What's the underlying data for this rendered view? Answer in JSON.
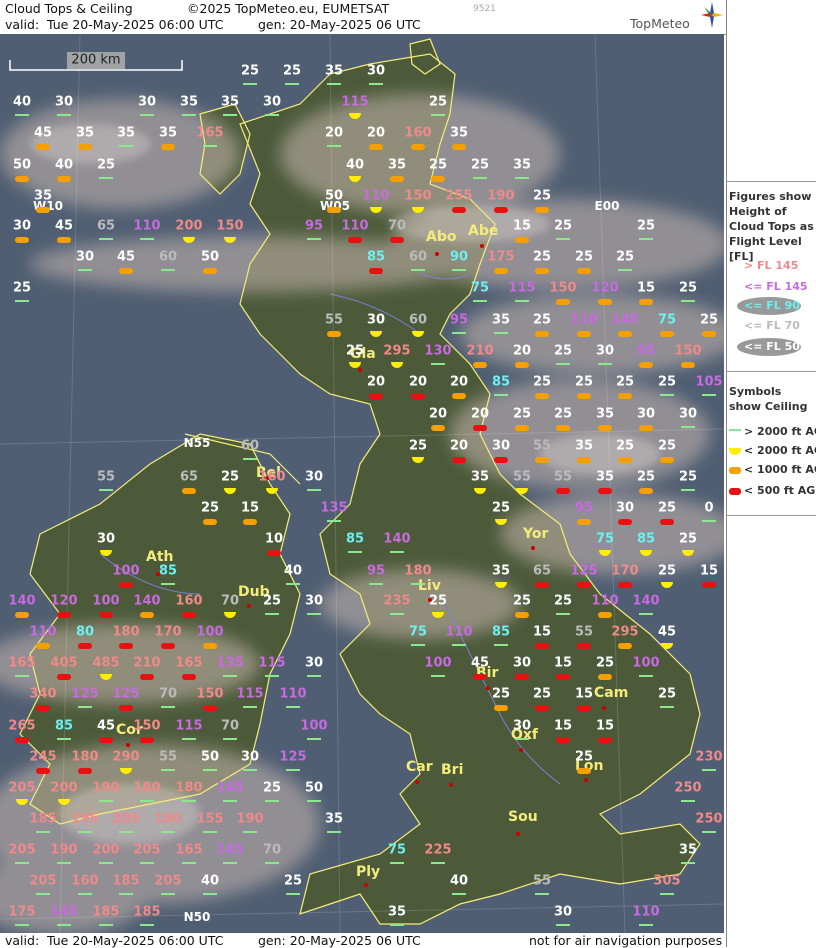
{
  "header": {
    "title": "Cloud Tops & Ceiling",
    "copyright": "©2025 TopMeteo.eu, EUMETSAT",
    "image_code": "9521",
    "valid_label": "valid:",
    "valid_time": "Tue   20-May-2025   06:00 UTC",
    "gen_time": "gen: 20-May-2025 06 UTC",
    "brand": "TopMeteo"
  },
  "footer": {
    "valid_label": "valid:",
    "valid_time": "Tue   20-May-2025   06:00 UTC",
    "gen_time": "gen: 20-May-2025 06 UTC",
    "disclaimer": "not for air navigation purposes"
  },
  "scale_bar": {
    "label": "200 km"
  },
  "grid_labels": [
    "W10",
    "W05",
    "E00",
    "N55",
    "N50"
  ],
  "cities": [
    "Abe",
    "Abo",
    "Gla",
    "Bel",
    "Dub",
    "Liv",
    "Yor",
    "Ath",
    "Bir",
    "Cam",
    "Oxf",
    "Car",
    "Bri",
    "Lon",
    "Sou",
    "Ply",
    "Cor"
  ],
  "legend": {
    "figures_title": "Figures show Height of Cloud Tops as Flight Level [FL]",
    "fl_entries": [
      {
        "label": "> FL 145",
        "color": "#f08a8a",
        "ellipse": false
      },
      {
        "label": "<= FL 145",
        "color": "#c86ae0",
        "ellipse": false
      },
      {
        "label": "<= FL 90",
        "color": "#6cf0f0",
        "ellipse": true
      },
      {
        "label": "<= FL 70",
        "color": "#bbbbbb",
        "ellipse": false
      },
      {
        "label": "<= FL 50",
        "color": "#ffffff",
        "ellipse": true
      }
    ],
    "symbols_title": "Symbols show Ceiling",
    "symbol_entries": [
      {
        "label": "> 2000 ft AGL",
        "shape": "line",
        "color": "#8ce88c"
      },
      {
        "label": "< 2000 ft AGL",
        "shape": "half-circle",
        "color": "#ffee00"
      },
      {
        "label": "< 1000 ft AGL",
        "shape": "bar",
        "color": "#f5a000"
      },
      {
        "label": "< 500 ft AGL",
        "shape": "bar",
        "color": "#e81010"
      }
    ]
  },
  "colors": {
    "fl_high": "#f08a8a",
    "fl_145": "#c86ae0",
    "fl_90": "#6cf0f0",
    "fl_70": "#bbbbbb",
    "fl_50": "#ffffff",
    "ceil_high": "#8ce88c",
    "ceil_2000": "#ffee00",
    "ceil_1000": "#f5a000",
    "ceil_500": "#e81010",
    "coast": "#f4ec7a",
    "sea": "#4f5e72",
    "land": "#4c5a3a",
    "river": "#7a80d0"
  },
  "rows": [
    {
      "cells": [
        [
          "25",
          "g"
        ],
        [
          "25",
          "g"
        ],
        [
          "35",
          "g"
        ],
        [
          "30",
          "g"
        ]
      ]
    },
    {
      "cells": [
        [
          "40",
          "g"
        ],
        [
          "30",
          "g"
        ],
        [
          "30",
          "g"
        ],
        [
          "35",
          "g"
        ],
        [
          "35",
          "g"
        ],
        [
          "30",
          "g"
        ],
        [
          "115",
          "y"
        ],
        [
          "25",
          "g"
        ]
      ]
    },
    {
      "cells": [
        [
          "45",
          "o"
        ],
        [
          "35",
          "o"
        ],
        [
          "35",
          "g"
        ],
        [
          "35",
          "o"
        ],
        [
          "165",
          "g"
        ],
        [
          "20",
          "g"
        ],
        [
          "20",
          "o"
        ],
        [
          "160",
          "o"
        ],
        [
          "35",
          "o"
        ]
      ]
    },
    {
      "cells": [
        [
          "50",
          "o"
        ],
        [
          "40",
          "o"
        ],
        [
          "25",
          "g"
        ],
        [
          "40",
          "y"
        ],
        [
          "35",
          "o"
        ],
        [
          "25",
          "o"
        ],
        [
          "25",
          "g"
        ],
        [
          "35",
          "g"
        ]
      ]
    },
    {
      "cells": [
        [
          "35",
          "o"
        ],
        [
          "50",
          "o"
        ],
        [
          "110",
          "y"
        ],
        [
          "150",
          "y"
        ],
        [
          "255",
          "r"
        ],
        [
          "190",
          "r"
        ],
        [
          "25",
          "o"
        ]
      ]
    },
    {
      "cells": [
        [
          "30",
          "o"
        ],
        [
          "45",
          "o"
        ],
        [
          "65",
          "g"
        ],
        [
          "110",
          "g"
        ],
        [
          "200",
          "y"
        ],
        [
          "150",
          "y"
        ],
        [
          "95",
          "g"
        ],
        [
          "110",
          "r"
        ],
        [
          "70",
          "r"
        ],
        [
          "15",
          "o"
        ],
        [
          "25",
          "g"
        ],
        [
          "25",
          "g"
        ]
      ]
    },
    {
      "cells": [
        [
          "30",
          "g"
        ],
        [
          "45",
          "o"
        ],
        [
          "60",
          "g"
        ],
        [
          "50",
          "o"
        ],
        [
          "85",
          "r"
        ],
        [
          "60",
          "g"
        ],
        [
          "90",
          "g"
        ],
        [
          "175",
          "o"
        ],
        [
          "25",
          "o"
        ],
        [
          "25",
          "o"
        ],
        [
          "25",
          "g"
        ]
      ]
    },
    {
      "cells": [
        [
          "25",
          "g"
        ],
        [
          "75",
          "g"
        ],
        [
          "115",
          "g"
        ],
        [
          "150",
          "o"
        ],
        [
          "120",
          "o"
        ],
        [
          "15",
          "o"
        ],
        [
          "25",
          "g"
        ]
      ]
    },
    {
      "cells": [
        [
          "55",
          "o"
        ],
        [
          "30",
          "y"
        ],
        [
          "60",
          "y"
        ],
        [
          "95",
          "g"
        ],
        [
          "35",
          "g"
        ],
        [
          "25",
          "o"
        ],
        [
          "110",
          "o"
        ],
        [
          "145",
          "o"
        ],
        [
          "75",
          "o"
        ],
        [
          "25",
          "o"
        ]
      ]
    },
    {
      "cells": [
        [
          "25",
          "y"
        ],
        [
          "295",
          "y"
        ],
        [
          "130",
          "g"
        ],
        [
          "210",
          "o"
        ],
        [
          "20",
          "o"
        ],
        [
          "25",
          "g"
        ],
        [
          "30",
          "g"
        ],
        [
          "95",
          "o"
        ],
        [
          "150",
          "o"
        ]
      ]
    },
    {
      "cells": [
        [
          "20",
          "r"
        ],
        [
          "20",
          "r"
        ],
        [
          "20",
          "o"
        ],
        [
          "85",
          "g"
        ],
        [
          "25",
          "o"
        ],
        [
          "25",
          "o"
        ],
        [
          "25",
          "o"
        ],
        [
          "25",
          "g"
        ],
        [
          "105",
          "g"
        ]
      ]
    },
    {
      "cells": [
        [
          "20",
          "o"
        ],
        [
          "20",
          "r"
        ],
        [
          "25",
          "o"
        ],
        [
          "25",
          "o"
        ],
        [
          "35",
          "o"
        ],
        [
          "30",
          "o"
        ],
        [
          "30",
          "g"
        ]
      ]
    },
    {
      "cells": [
        [
          "60",
          "g"
        ],
        [
          "25",
          "y"
        ],
        [
          "20",
          "r"
        ],
        [
          "30",
          "r"
        ],
        [
          "55",
          "o"
        ],
        [
          "35",
          "o"
        ],
        [
          "25",
          "o"
        ],
        [
          "25",
          "o"
        ]
      ]
    },
    {
      "cells": [
        [
          "55",
          "g"
        ],
        [
          "65",
          "o"
        ],
        [
          "25",
          "y"
        ],
        [
          "160",
          "y"
        ],
        [
          "30",
          "g"
        ],
        [
          "35",
          "y"
        ],
        [
          "55",
          "y"
        ],
        [
          "55",
          "r"
        ],
        [
          "35",
          "r"
        ],
        [
          "25",
          "o"
        ],
        [
          "25",
          "g"
        ]
      ]
    },
    {
      "cells": [
        [
          "25",
          "o"
        ],
        [
          "15",
          "o"
        ],
        [
          "135",
          "g"
        ],
        [
          "25",
          "y"
        ],
        [
          "95",
          "o"
        ],
        [
          "30",
          "r"
        ],
        [
          "25",
          "r"
        ],
        [
          "0",
          "g"
        ]
      ]
    },
    {
      "cells": [
        [
          "30",
          "y"
        ],
        [
          "85",
          "g"
        ],
        [
          "140",
          "g"
        ],
        [
          "85",
          "y"
        ],
        [
          "75",
          "y"
        ],
        [
          "25",
          "y"
        ],
        [
          "10",
          "r"
        ]
      ]
    },
    {
      "cells": [
        [
          "100",
          "r"
        ],
        [
          "85",
          "g"
        ],
        [
          "40",
          "g"
        ],
        [
          "95",
          "g"
        ],
        [
          "180",
          "g"
        ],
        [
          "35",
          "y"
        ],
        [
          "65",
          "r"
        ],
        [
          "125",
          "r"
        ],
        [
          "170",
          "r"
        ],
        [
          "25",
          "y"
        ],
        [
          "15",
          "r"
        ]
      ]
    },
    {
      "cells": [
        [
          "140",
          "o"
        ],
        [
          "120",
          "r"
        ],
        [
          "100",
          "r"
        ],
        [
          "140",
          "o"
        ],
        [
          "160",
          "r"
        ],
        [
          "70",
          "y"
        ],
        [
          "25",
          "g"
        ],
        [
          "30",
          "g"
        ],
        [
          "235",
          "g"
        ],
        [
          "25",
          "y"
        ],
        [
          "25",
          "o"
        ],
        [
          "25",
          "g"
        ],
        [
          "110",
          "o"
        ],
        [
          "140",
          "g"
        ]
      ]
    },
    {
      "cells": [
        [
          "110",
          "o"
        ],
        [
          "80",
          "r"
        ],
        [
          "180",
          "r"
        ],
        [
          "170",
          "r"
        ],
        [
          "100",
          "o"
        ],
        [
          "75",
          "g"
        ],
        [
          "110",
          "g"
        ],
        [
          "85",
          "g"
        ],
        [
          "15",
          "r"
        ],
        [
          "55",
          "r"
        ],
        [
          "295",
          "o"
        ],
        [
          "45",
          "y"
        ]
      ]
    },
    {
      "cells": [
        [
          "165",
          "g"
        ],
        [
          "405",
          "r"
        ],
        [
          "485",
          "y"
        ],
        [
          "210",
          "r"
        ],
        [
          "165",
          "r"
        ],
        [
          "135",
          "g"
        ],
        [
          "115",
          "g"
        ],
        [
          "30",
          "g"
        ],
        [
          "100",
          "g"
        ],
        [
          "45",
          "r"
        ],
        [
          "30",
          "r"
        ],
        [
          "15",
          "r"
        ],
        [
          "25",
          "o"
        ],
        [
          "100",
          "g"
        ]
      ]
    },
    {
      "cells": [
        [
          "340",
          "r"
        ],
        [
          "125",
          "g"
        ],
        [
          "125",
          "r"
        ],
        [
          "70",
          "g"
        ],
        [
          "150",
          "r"
        ],
        [
          "115",
          "g"
        ],
        [
          "110",
          "g"
        ],
        [
          "25",
          "o"
        ],
        [
          "25",
          "r"
        ],
        [
          "15",
          "r"
        ],
        [
          "25",
          "g"
        ]
      ]
    },
    {
      "cells": [
        [
          "265",
          "r"
        ],
        [
          "85",
          "g"
        ],
        [
          "45",
          "r"
        ],
        [
          "150",
          "r"
        ],
        [
          "115",
          "g"
        ],
        [
          "70",
          "g"
        ],
        [
          "100",
          "g"
        ],
        [
          "30",
          "g"
        ],
        [
          "15",
          "r"
        ],
        [
          "15",
          "r"
        ]
      ]
    },
    {
      "cells": [
        [
          "245",
          "r"
        ],
        [
          "180",
          "r"
        ],
        [
          "290",
          "y"
        ],
        [
          "55",
          "g"
        ],
        [
          "50",
          "g"
        ],
        [
          "30",
          "g"
        ],
        [
          "125",
          "g"
        ],
        [
          "25",
          "o"
        ],
        [
          "230",
          "g"
        ]
      ]
    },
    {
      "cells": [
        [
          "205",
          "y"
        ],
        [
          "200",
          "y"
        ],
        [
          "190",
          "g"
        ],
        [
          "180",
          "g"
        ],
        [
          "180",
          "g"
        ],
        [
          "145",
          "g"
        ],
        [
          "25",
          "g"
        ],
        [
          "50",
          "g"
        ],
        [
          "250",
          "g"
        ]
      ]
    },
    {
      "cells": [
        [
          "185",
          "g"
        ],
        [
          "195",
          "g"
        ],
        [
          "205",
          "g"
        ],
        [
          "180",
          "g"
        ],
        [
          "155",
          "g"
        ],
        [
          "190",
          "g"
        ],
        [
          "35",
          "g"
        ],
        [
          "250",
          "g"
        ]
      ]
    },
    {
      "cells": [
        [
          "205",
          "g"
        ],
        [
          "190",
          "g"
        ],
        [
          "200",
          "g"
        ],
        [
          "205",
          "g"
        ],
        [
          "165",
          "g"
        ],
        [
          "145",
          "g"
        ],
        [
          "70",
          "g"
        ],
        [
          "75",
          "g"
        ],
        [
          "225",
          "g"
        ],
        [
          "35",
          "g"
        ]
      ]
    },
    {
      "cells": [
        [
          "205",
          "g"
        ],
        [
          "160",
          "g"
        ],
        [
          "185",
          "g"
        ],
        [
          "205",
          "g"
        ],
        [
          "40",
          "g"
        ],
        [
          "25",
          "g"
        ],
        [
          "40",
          "g"
        ],
        [
          "55",
          "g"
        ],
        [
          "305",
          "g"
        ]
      ]
    },
    {
      "cells": [
        [
          "175",
          "g"
        ],
        [
          "145",
          "g"
        ],
        [
          "185",
          "g"
        ],
        [
          "185",
          "g"
        ],
        [
          "35",
          "g"
        ],
        [
          "30",
          "g"
        ],
        [
          "110",
          "g"
        ]
      ]
    }
  ]
}
